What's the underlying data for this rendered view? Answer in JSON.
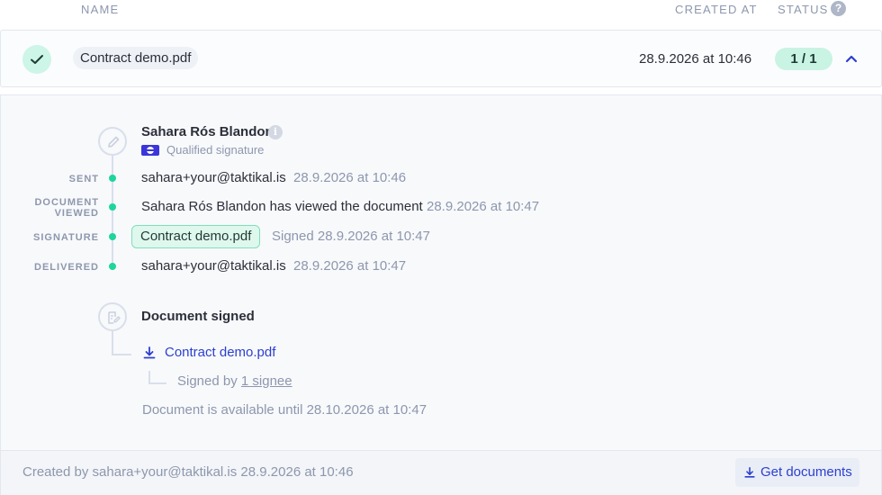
{
  "columns": {
    "name": "NAME",
    "created_at": "CREATED AT",
    "status": "STATUS",
    "status_help": "?"
  },
  "document_row": {
    "file_name": "Contract demo.pdf",
    "created": "28.9.2026 at 10:46",
    "status": "1 / 1"
  },
  "signer": {
    "name": "Sahara Rós Blandon",
    "info": "i",
    "signature_type": "Qualified signature"
  },
  "events": [
    {
      "label": "SENT",
      "text": "sahara+your@taktikal.is",
      "time": "28.9.2026 at 10:46"
    },
    {
      "label_line1": "DOCUMENT",
      "label_line2": "VIEWED",
      "text": "Sahara Rós Blandon has viewed the document",
      "time": "28.9.2026 at 10:47"
    },
    {
      "label": "SIGNATURE",
      "file": "Contract demo.pdf",
      "text": "Signed 28.9.2026 at 10:47"
    },
    {
      "label": "DELIVERED",
      "text": "sahara+your@taktikal.is",
      "time": "28.9.2026 at 10:47"
    }
  ],
  "signed_section": {
    "title": "Document signed",
    "download_file": "Contract demo.pdf",
    "signed_by_prefix": "Signed by",
    "signee_link": "1 signee",
    "availability": "Document is available until 28.10.2026 at 10:47"
  },
  "footer": {
    "created_by": "Created by sahara+your@taktikal.is 28.9.2026 at 10:46",
    "get_documents": "Get documents"
  },
  "colors": {
    "accent_green": "#1fd59b",
    "status_bg": "#c9f3e3",
    "link_blue": "#2c3fd0",
    "muted": "#8d97ad"
  }
}
